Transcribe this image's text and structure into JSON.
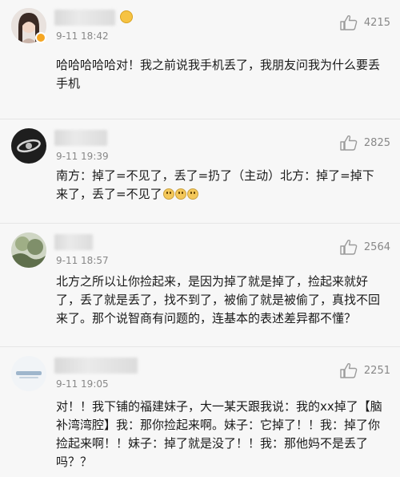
{
  "comments": [
    {
      "time": "9-11 18:42",
      "likes": "4215",
      "text": "哈哈哈哈哈对！我之前说我手机丢了，我朋友问我为什么要丢手机"
    },
    {
      "time": "9-11 19:39",
      "likes": "2825",
      "text": "南方：掉了=不见了，丢了=扔了（主动）北方：掉了=掉下来了，丢了=不见了"
    },
    {
      "time": "9-11 18:57",
      "likes": "2564",
      "text": "北方之所以让你捡起来，是因为掉了就是掉了，捡起来就好了，丢了就是丢了，找不到了，被偷了就是被偷了，真找不回来了。那个说智商有问题的，连基本的表述差异都不懂？"
    },
    {
      "time": "9-11 19:05",
      "likes": "2251",
      "text": "对！！我下铺的福建妹子，大一某天跟我说：我的xx掉了【脑补湾湾腔】我：那你捡起来啊。妹子：它掉了！！我：掉了你捡起来啊！！妹子：掉了就是没了！！我：那他妈不是丢了吗？？"
    }
  ],
  "icons": {
    "like": "thumbs-up-icon",
    "verified": "verified-badge-icon"
  },
  "colors": {
    "like_icon": "#9b9b9b",
    "meta_text": "#888888",
    "body_text": "#1a1a1a",
    "badge": "#f5a623"
  }
}
